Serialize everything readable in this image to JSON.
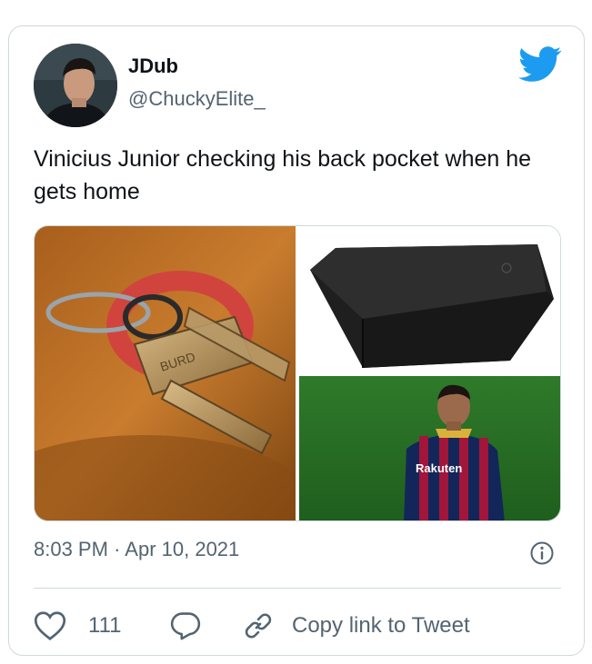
{
  "author": {
    "display_name": "JDub",
    "handle": "@ChuckyElite_"
  },
  "tweet": {
    "text": "Vinicius Junior checking his back pocket when he gets home",
    "time": "8:03 PM",
    "separator": "·",
    "date": "Apr 10, 2021"
  },
  "media": {
    "images": [
      "keys-icon",
      "wallet-icon",
      "soccer-player-icon"
    ],
    "key_engraving": "BURD",
    "jersey_sponsor": "Rakuten"
  },
  "actions": {
    "like_count": "111",
    "copy_link_label": "Copy link to Tweet"
  },
  "colors": {
    "brand": "#1d9bf0",
    "text": "#0f1419",
    "secondary": "#536471",
    "border": "#cfd9de"
  }
}
